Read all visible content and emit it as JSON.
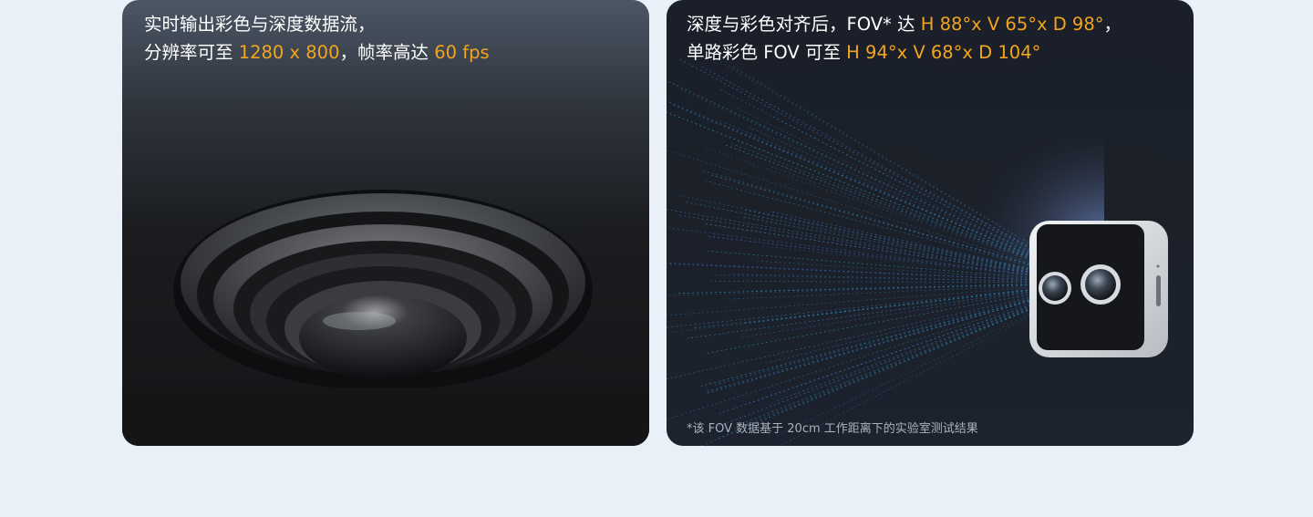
{
  "left_card": {
    "line1": "实时输出彩色与深度数据流，",
    "line2_prefix": "分辨率可至 ",
    "line2_resolution": "1280 x 800",
    "line2_middle": "，帧率高达 ",
    "line2_fps": "60 fps"
  },
  "right_card": {
    "line1_prefix": "深度与彩色对齐后，FOV* 达 ",
    "line1_fov": "H 88°x V 65°x D 98°",
    "line1_suffix": "，",
    "line2_prefix": "单路彩色 FOV 可至 ",
    "line2_fov": "H 94°x V 68°x D 104°",
    "footnote": "*该 FOV 数据基于 20cm 工作距离下的实验室测试结果"
  },
  "colors": {
    "page_background": "#e9f0f7",
    "highlight": "#f3a51f",
    "text": "#ffffff",
    "footnote": "#aab2bd"
  },
  "icons": {
    "left_image": "camera-lens-closeup-image",
    "right_image": "depth-camera-fov-rays-image"
  }
}
